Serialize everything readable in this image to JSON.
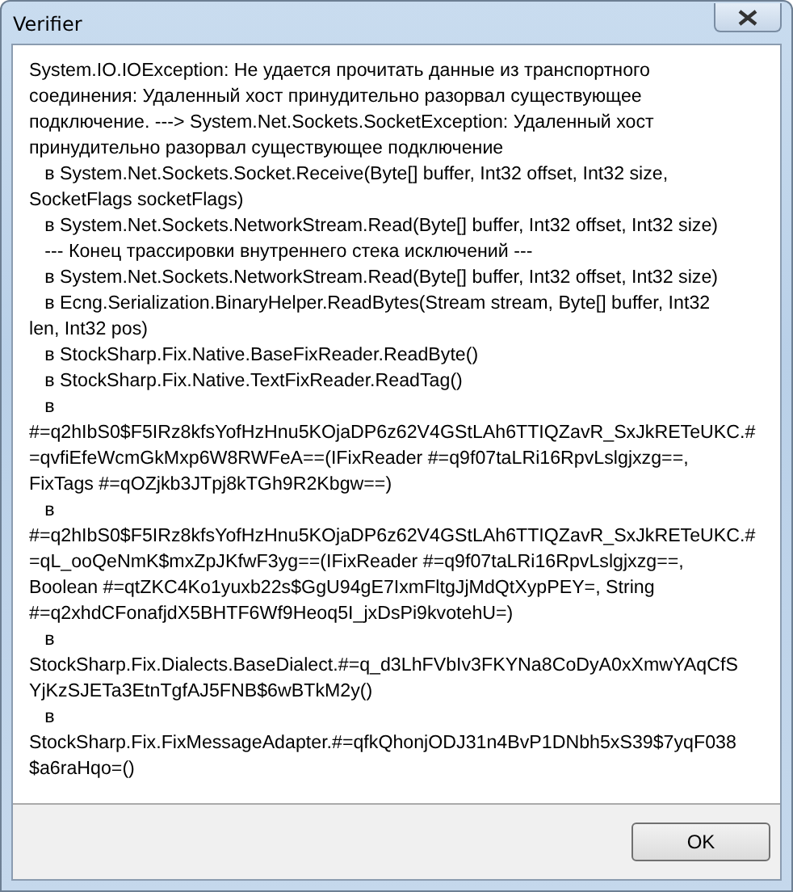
{
  "window": {
    "title": "Verifier"
  },
  "message_lines": [
    "System.IO.IOException: Не удается прочитать данные из транспортного",
    "соединения: Удаленный хост принудительно разорвал существующее",
    "подключение. ---> System.Net.Sockets.SocketException: Удаленный хост",
    "принудительно разорвал существующее подключение",
    "   в System.Net.Sockets.Socket.Receive(Byte[] buffer, Int32 offset, Int32 size,",
    "SocketFlags socketFlags)",
    "   в System.Net.Sockets.NetworkStream.Read(Byte[] buffer, Int32 offset, Int32 size)",
    "   --- Конец трассировки внутреннего стека исключений ---",
    "   в System.Net.Sockets.NetworkStream.Read(Byte[] buffer, Int32 offset, Int32 size)",
    "   в Ecng.Serialization.BinaryHelper.ReadBytes(Stream stream, Byte[] buffer, Int32",
    "len, Int32 pos)",
    "   в StockSharp.Fix.Native.BaseFixReader.ReadByte()",
    "   в StockSharp.Fix.Native.TextFixReader.ReadTag()",
    "   в",
    "#=q2hIbS0$F5IRz8kfsYofHzHnu5KOjaDP6z62V4GStLAh6TTIQZavR_SxJkRETeUKC.#",
    "=qvfiEfeWcmGkMxp6W8RWFeA==(IFixReader #=q9f07taLRi16RpvLslgjxzg==,",
    "FixTags #=qOZjkb3JTpj8kTGh9R2Kbgw==)",
    "   в",
    "#=q2hIbS0$F5IRz8kfsYofHzHnu5KOjaDP6z62V4GStLAh6TTIQZavR_SxJkRETeUKC.#",
    "=qL_ooQeNmK$mxZpJKfwF3yg==(IFixReader #=q9f07taLRi16RpvLslgjxzg==,",
    "Boolean #=qtZKC4Ko1yuxb22s$GgU94gE7IxmFltgJjMdQtXypPEY=, String",
    "#=q2xhdCFonafjdX5BHTF6Wf9Heoq5I_jxDsPi9kvotehU=)",
    "   в",
    "StockSharp.Fix.Dialects.BaseDialect.#=q_d3LhFVbIv3FKYNa8CoDyA0xXmwYAqCfS",
    "YjKzSJETa3EtnTgfAJ5FNB$6wBTkM2y()",
    "   в",
    "StockSharp.Fix.FixMessageAdapter.#=qfkQhonjODJ31n4BvP1DNbh5xS39$7yqF038",
    "$a6raHqo=()"
  ],
  "buttons": [
    "OK"
  ]
}
